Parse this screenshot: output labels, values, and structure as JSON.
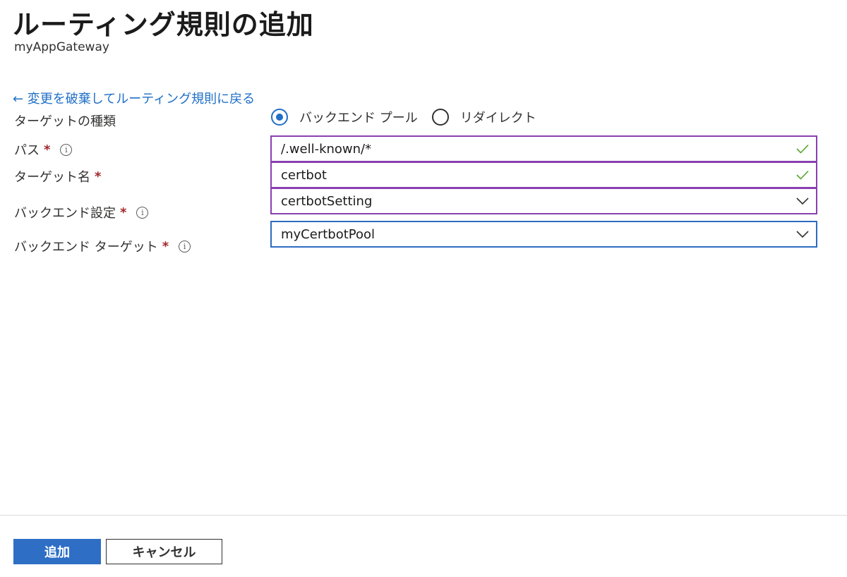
{
  "header": {
    "title": "ルーティング規則の追加",
    "subtitle": "myAppGateway"
  },
  "back_link": "← 変更を破棄してルーティング規則に戻る",
  "form": {
    "target_type": {
      "label": "ターゲットの種類",
      "options": [
        {
          "label": "バックエンド プール",
          "selected": true
        },
        {
          "label": "リダイレクト",
          "selected": false
        }
      ]
    },
    "path": {
      "label": "パス",
      "required_mark": "*",
      "value": "/.well-known/*"
    },
    "target_name": {
      "label": "ターゲット名",
      "required_mark": "*",
      "value": "certbot"
    },
    "backend_settings": {
      "label": "バックエンド設定",
      "required_mark": "*",
      "value": "certbotSetting"
    },
    "backend_target": {
      "label": "バックエンド ターゲット",
      "required_mark": "*",
      "value": "myCertbotPool"
    }
  },
  "info_glyph": "i",
  "buttons": {
    "add": "追加",
    "cancel": "キャンセル"
  },
  "colors": {
    "link": "#1f6fc7",
    "primary_button": "#2e6fc5",
    "field_border": "#8a3fb0",
    "focused_border": "#2d6cc0",
    "valid_check": "#5aa832",
    "required": "#a4262c"
  },
  "icons": {
    "valid": "checkmark-icon",
    "dropdown": "chevron-down-icon",
    "info": "info-icon"
  }
}
